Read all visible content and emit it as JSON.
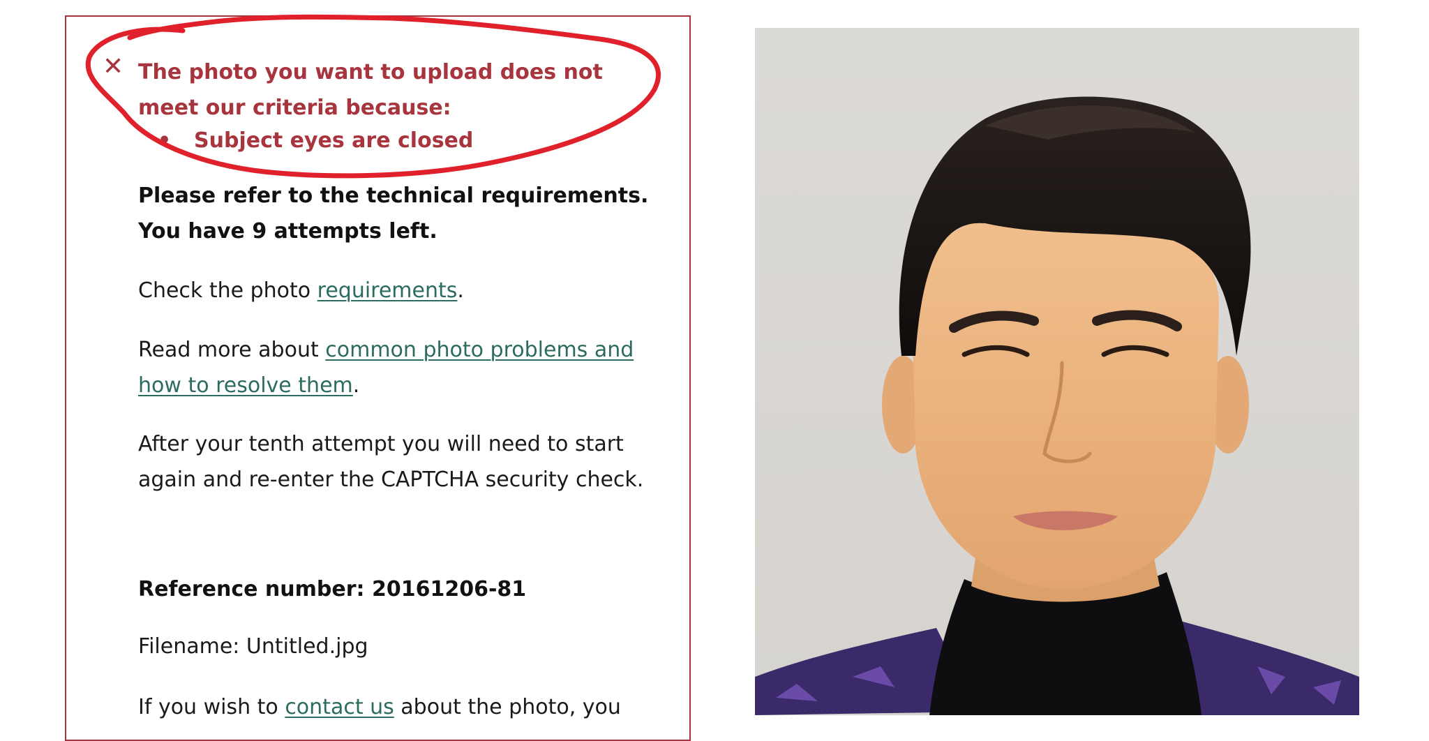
{
  "error_box": {
    "icon": "close-icon",
    "headline": "The photo you want to upload does not meet our criteria because:",
    "reasons": [
      "Subject eyes are closed"
    ],
    "color": "#a8343d"
  },
  "guidance": {
    "technical_line": "Please refer to the technical requirements.",
    "attempts_line": "You have 9 attempts left.",
    "check_prefix": "Check the photo ",
    "check_link": "requirements",
    "check_suffix": ".",
    "read_prefix": "Read more about ",
    "read_link": "common photo problems and how to resolve them",
    "read_suffix": ".",
    "tenth_attempt": "After your tenth attempt you will need to start again and re-enter the CAPTCHA security check.",
    "reference": "Reference number: 20161206-81",
    "filename": "Filename: Untitled.jpg",
    "contact_prefix": "If you wish to ",
    "contact_link": "contact us",
    "contact_suffix": " about the photo, you"
  },
  "colors": {
    "error": "#a8343d",
    "link": "#2c6b5f",
    "annotation": "#e0202a"
  },
  "photo": {
    "subject": "uploaded-portrait-photo"
  }
}
